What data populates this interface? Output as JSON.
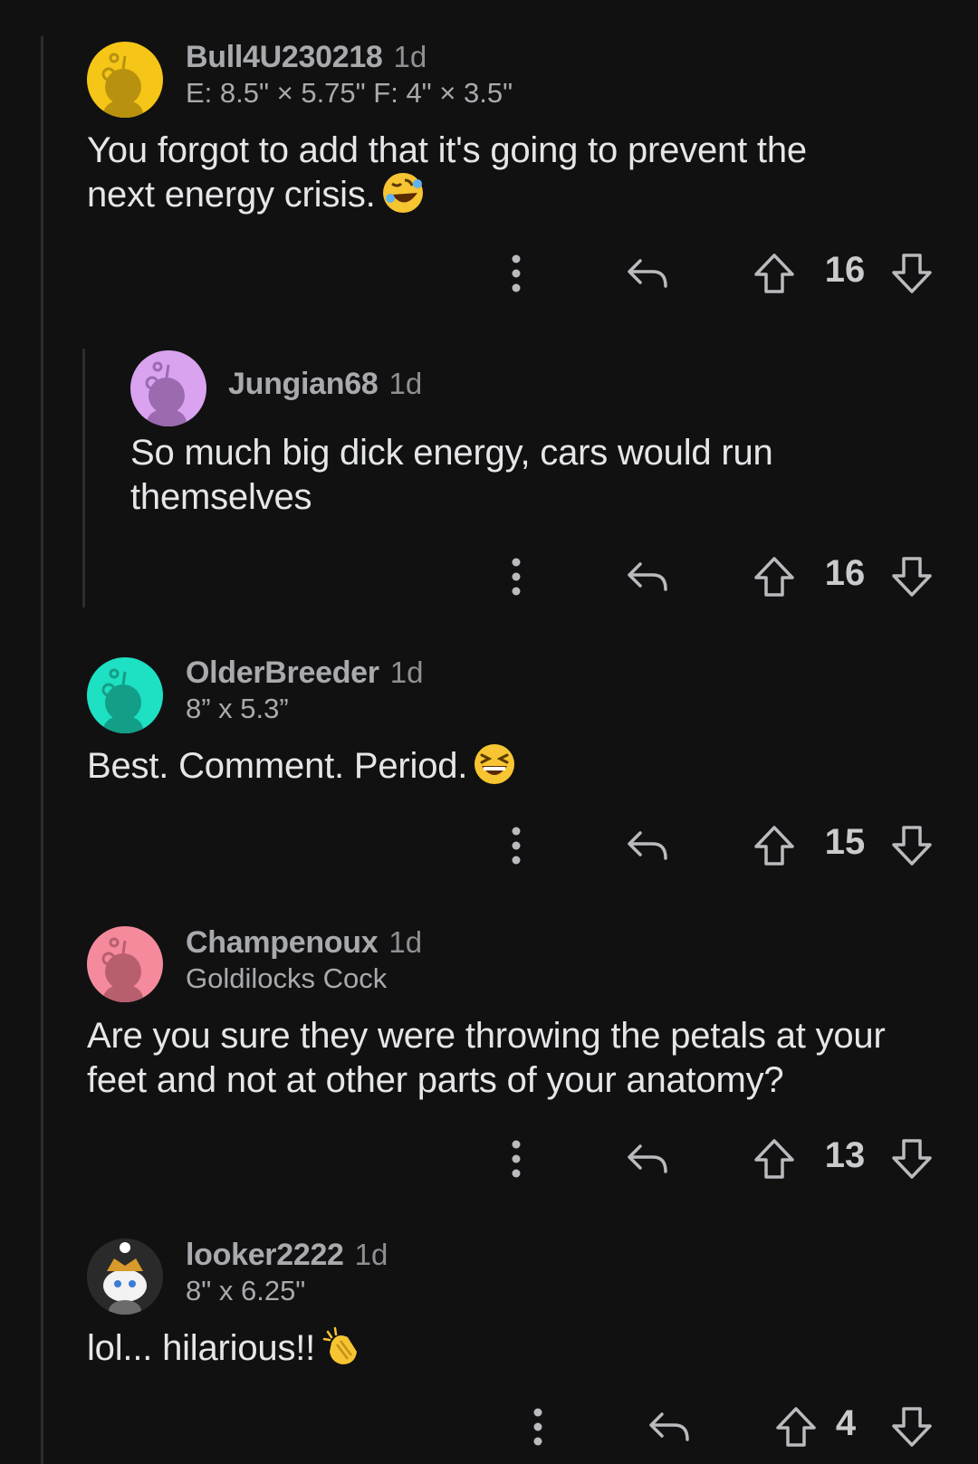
{
  "comments": [
    {
      "author": "Bull4U230218",
      "time": "1d",
      "flair": "E: 8.5\" × 5.75\" F: 4\" × 3.5\"",
      "body": "You forgot to add that it's going to prevent the next energy crisis.",
      "emoji": "rolling-on-floor-laughing-emoji",
      "score": "16",
      "avatar_color": "#f5c518"
    },
    {
      "author": "Jungian68",
      "time": "1d",
      "flair": "",
      "body": "So much big dick energy, cars would run themselves",
      "score": "16",
      "avatar_color": "#d9a3f0"
    },
    {
      "author": "OlderBreeder",
      "time": "1d",
      "flair": "8” x 5.3”",
      "body": "Best. Comment. Period.",
      "emoji": "grinning-squinting-face-emoji",
      "score": "15",
      "avatar_color": "#1ee0c2"
    },
    {
      "author": "Champenoux",
      "time": "1d",
      "flair": "Goldilocks Cock",
      "body": "Are you sure they were throwing the petals at your feet and not at other parts of your anatomy?",
      "score": "13",
      "avatar_color": "#f58a9c"
    },
    {
      "author": "looker2222",
      "time": "1d",
      "flair": "8\" x 6.25\"",
      "body": "lol... hilarious!!",
      "emoji": "clapping-hands-emoji",
      "score": "4",
      "avatar_color": "#2a2a2a"
    }
  ]
}
